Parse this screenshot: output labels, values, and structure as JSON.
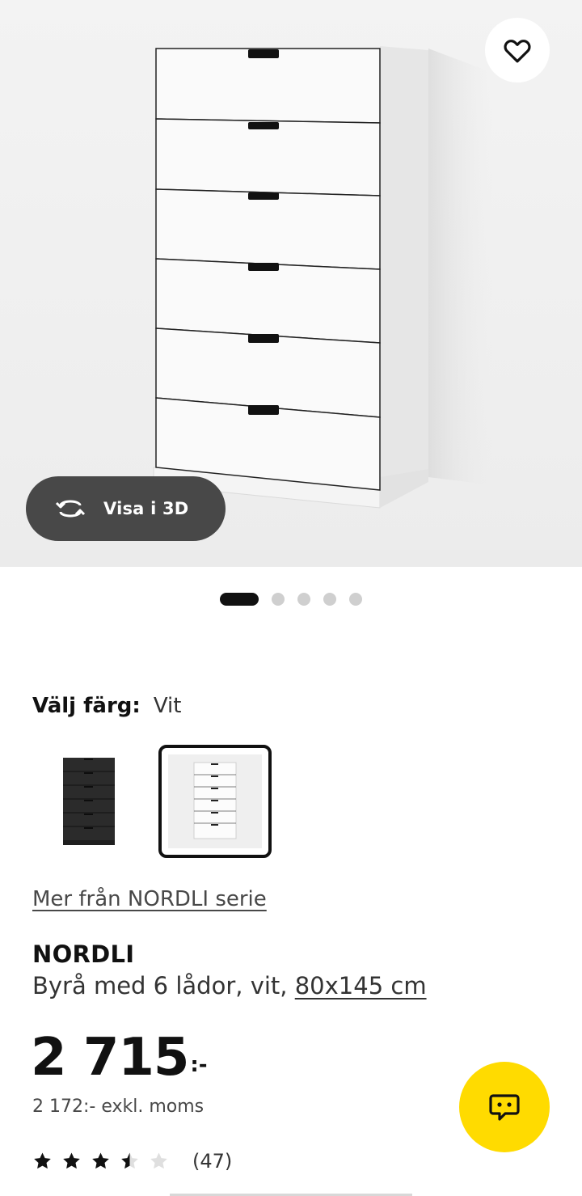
{
  "hero": {
    "favorite_icon": "heart-outline-icon",
    "view3d": {
      "icon": "rotate-3d-icon",
      "label": "Visa i 3D"
    },
    "carousel": {
      "total": 5,
      "active_index": 0
    }
  },
  "color_selector": {
    "label": "Välj färg:",
    "selected_value": "Vit",
    "options": [
      {
        "name": "black-dresser-thumbnail",
        "color": "#2b2b2b",
        "selected": false
      },
      {
        "name": "white-dresser-thumbnail",
        "color": "#ffffff",
        "selected": true
      }
    ]
  },
  "series_link": "Mer från NORDLI serie",
  "product": {
    "name": "NORDLI",
    "description": "Byrå med 6 lådor, vit,",
    "size": "80x145 cm"
  },
  "price": {
    "main": "2 715",
    "suffix": ":-",
    "excl_vat": "2 172:- exkl. moms"
  },
  "rating": {
    "value": 3.5,
    "max": 5,
    "count": "(47)"
  },
  "chat": {
    "icon": "chat-bubble-icon",
    "color": "#ffdb00"
  },
  "colors": {
    "dark_button": "#484848",
    "accent_yellow": "#ffdb00",
    "text": "#111111"
  }
}
